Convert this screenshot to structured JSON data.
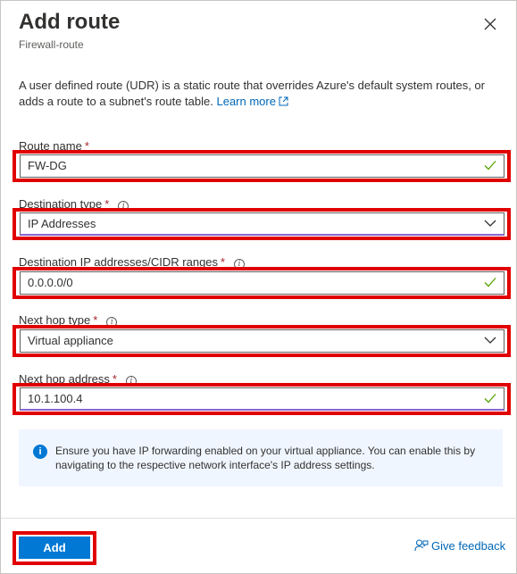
{
  "header": {
    "title": "Add route",
    "subtitle": "Firewall-route"
  },
  "description": {
    "text": "A user defined route (UDR) is a static route that overrides Azure's default system routes, or adds a route to a subnet's route table.",
    "link": "Learn more"
  },
  "form": {
    "route_name": {
      "label": "Route name",
      "required": "*",
      "value": "FW-DG"
    },
    "destination_type": {
      "label": "Destination type",
      "required": "*",
      "value": "IP Addresses"
    },
    "destination_ip": {
      "label": "Destination IP addresses/CIDR ranges",
      "required": "*",
      "value": "0.0.0.0/0"
    },
    "next_hop_type": {
      "label": "Next hop type",
      "required": "*",
      "value": "Virtual appliance"
    },
    "next_hop_address": {
      "label": "Next hop address",
      "required": "*",
      "value": "10.1.100.4"
    }
  },
  "info_message": "Ensure you have IP forwarding enabled on your virtual appliance. You can enable this by navigating to the respective network interface's IP address settings.",
  "footer": {
    "add_label": "Add",
    "feedback_label": "Give feedback"
  },
  "colors": {
    "accent": "#0078d4",
    "highlight": "#e00000",
    "valid": "#57a300"
  },
  "icons": [
    "close-icon",
    "external-link-icon",
    "info-icon",
    "checkmark-icon",
    "chevron-down-icon",
    "feedback-icon"
  ]
}
